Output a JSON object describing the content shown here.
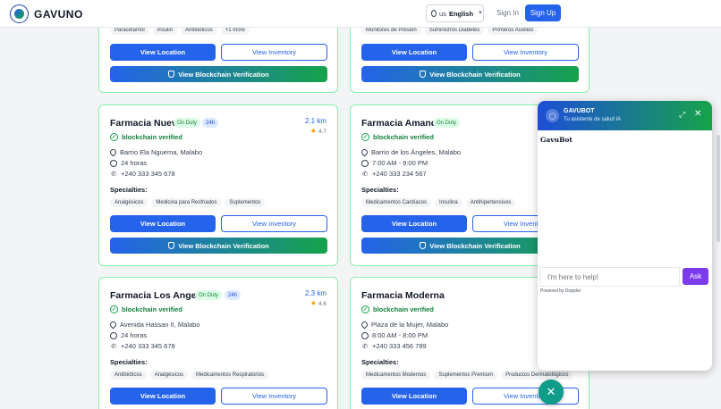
{
  "header": {
    "brand": "GAVUNO",
    "lang_code": "us",
    "lang_label": "English",
    "signin": "Sign In",
    "signup": "Sign Up"
  },
  "common": {
    "view_location": "View Location",
    "view_inventory": "View Inventory",
    "blockchain": "View Blockchain Verification",
    "verified": "blockchain verified",
    "specialties": "Specialties:",
    "on_duty": "On Duty",
    "h24": "24h"
  },
  "top_left": {
    "tags": [
      "Paracetamol",
      "Insulin",
      "Antibioticos",
      "+1 more"
    ]
  },
  "top_right": {
    "tags": [
      "Monitores de Presión",
      "Suministros Diabetes",
      "Primeros Auxilios"
    ]
  },
  "card1": {
    "name": "Farmacia Nueva",
    "distance": "2.1 km",
    "rating": "4.7",
    "address": "Barrio Ela Nguema, Malabo",
    "hours": "24 horas",
    "phone": "+240 333 345 678",
    "tags": [
      "Analgésicos",
      "Medicina para Resfriados",
      "Suplementos"
    ]
  },
  "card2": {
    "name": "Farmacia Amanda",
    "address": "Barrio de los Ángeles, Malabo",
    "hours": "7:00 AM - 9:00 PM",
    "phone": "+240 333 234 567",
    "tags": [
      "Medicamentos Cardíacos",
      "Insulina",
      "Antihipertensivos"
    ]
  },
  "card3": {
    "name": "Farmacia Los Angeles",
    "distance": "2.3 km",
    "rating": "4.6",
    "address": "Avenida Hassan II, Malabo",
    "hours": "24 horas",
    "phone": "+240 333 345 678",
    "tags": [
      "Antibióticos",
      "Analgésicos",
      "Medicamentos Respiratorios"
    ]
  },
  "card4": {
    "name": "Farmacia Moderna",
    "address": "Plaza de la Mujer, Malabo",
    "hours": "8:00 AM - 8:00 PM",
    "phone": "+240 333 456 789",
    "tags": [
      "Medicamentos Modernos",
      "Suplementos Premium",
      "Productos Dermatológicos"
    ]
  },
  "chat": {
    "title": "GAVUBOT",
    "subtitle": "Tu asistente de salud IA",
    "botname": "GavuBot",
    "placeholder": "I'm here to help!",
    "ask": "Ask",
    "powered": "Powered by  Doppler"
  },
  "colors": {
    "primary": "#2563eb",
    "accent": "#16a34a",
    "ask": "#7c3aed",
    "fab": "#0f9d8a"
  }
}
